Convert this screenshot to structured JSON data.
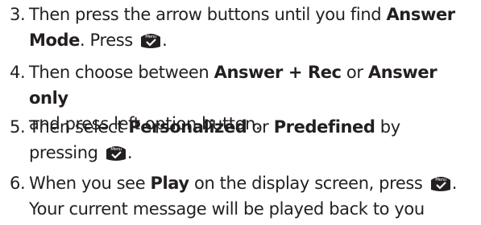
{
  "steps": [
    {
      "number": "3.",
      "t1": "Then press the arrow buttons until you find ",
      "b1": "Answer",
      "b1b": "Mode",
      "t2": ". Press ",
      "t3": "."
    },
    {
      "number": "4.",
      "t1": "Then choose between ",
      "b1": "Answer + Rec",
      "t2": " or ",
      "b2": "Answer only",
      "t3": "and press left option button."
    },
    {
      "number": "5.",
      "t1": "Then select ",
      "b1": "Personalized",
      "t2": " or ",
      "b2": "Predefined",
      "t3": " by",
      "t4": "pressing ",
      "t5": "."
    },
    {
      "number": "6.",
      "t1": "When you see ",
      "b1": "Play",
      "t2": " on the display screen, press ",
      "t3": ".",
      "t4": "Your current message will be played back to you"
    }
  ],
  "key": {
    "label": "Menu",
    "icon": "menu-ok-key-icon",
    "color": "#231f20"
  }
}
